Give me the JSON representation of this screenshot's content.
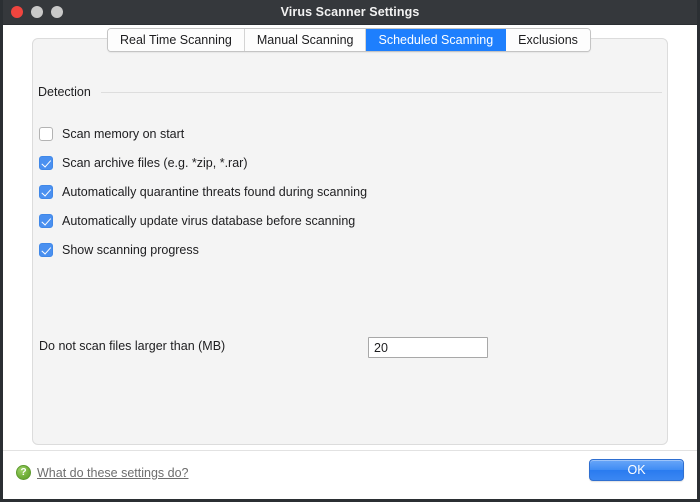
{
  "window": {
    "title": "Virus Scanner Settings",
    "traffic_lights": [
      {
        "name": "close",
        "color": "#f0453f"
      },
      {
        "name": "minimize",
        "color": "#c9c9c9"
      },
      {
        "name": "zoom",
        "color": "#c9c9c9"
      }
    ]
  },
  "tabs": [
    {
      "label": "Real Time Scanning",
      "selected": false
    },
    {
      "label": "Manual Scanning",
      "selected": false
    },
    {
      "label": "Scheduled Scanning",
      "selected": true
    },
    {
      "label": "Exclusions",
      "selected": false
    }
  ],
  "section": {
    "title": "Detection"
  },
  "checkboxes": [
    {
      "label": "Scan memory on start",
      "checked": false
    },
    {
      "label": "Scan archive files (e.g. *zip, *.rar)",
      "checked": true
    },
    {
      "label": "Automatically quarantine threats found during scanning",
      "checked": true
    },
    {
      "label": "Automatically update virus database before scanning",
      "checked": true
    },
    {
      "label": "Show scanning progress",
      "checked": true
    }
  ],
  "size_limit": {
    "label": "Do not scan files larger than (MB)",
    "value": "20",
    "placeholder": ""
  },
  "footer": {
    "help_icon": "question-mark-icon",
    "help_link": "What do these settings do?",
    "ok_label": "OK"
  },
  "colors": {
    "titlebar": "#35383c",
    "accent_tab": "#1e7ffd",
    "checkbox_checked": "#4a90f0",
    "ok_button": "#3f8cf4",
    "help_icon_green": "#74b13c",
    "panel_bg": "#f4f4f4"
  }
}
